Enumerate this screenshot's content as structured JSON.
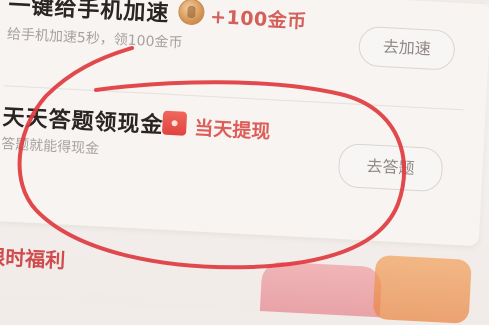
{
  "tasks": [
    {
      "title": "一键给手机加速",
      "reward": "+100金币",
      "description": "给手机加速5秒，领100金币",
      "button": "去加速"
    },
    {
      "title": "天天答题领现金",
      "badge": "当天提现",
      "description": "答题就能得现金",
      "button": "去答题"
    }
  ],
  "bottom": {
    "title": "限时福利"
  },
  "colors": {
    "reward": "#d3605a",
    "annotation": "#e0393f",
    "section_title": "#cf4b4d"
  },
  "icons": {
    "coin": "coin-icon",
    "red_packet": "red-packet-icon"
  }
}
